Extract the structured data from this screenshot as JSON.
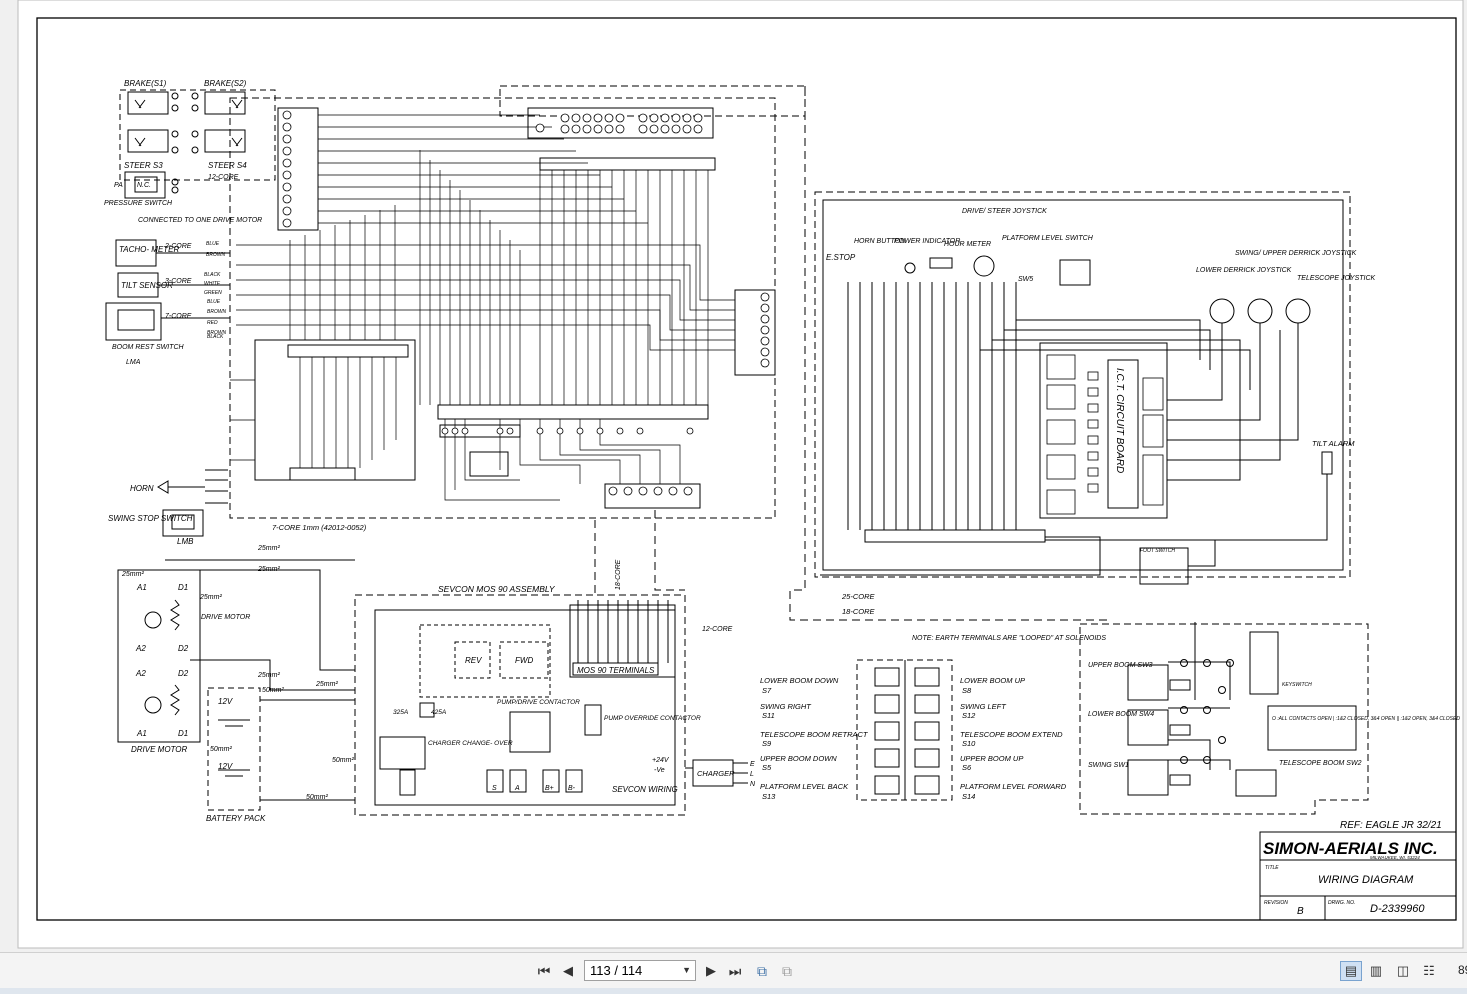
{
  "diagram": {
    "components": {
      "brake_s1": "BRAKE(S1)",
      "brake_s2": "BRAKE(S2)",
      "steer_s3": "STEER S3",
      "steer_s4": "STEER S4",
      "twelve_core": "12-CORE",
      "pressure_switch": "PRESSURE SWITCH",
      "pa": "PA",
      "nc": "N.C.",
      "connected_drive_motor": "CONNECTED TO ONE DRIVE MOTOR",
      "tachometer": "TACHO- METER",
      "two_core": "2-CORE",
      "tilt_sensor": "TILT SENSOR",
      "three_core": "3-CORE",
      "seven_core": "7-CORE",
      "boom_rest_switch": "BOOM REST SWITCH",
      "lma": "LMA",
      "horn": "HORN",
      "swing_stop_switch": "SWING STOP SWITCH",
      "lmb": "LMB",
      "seven_core_1mm": "7-CORE 1mm (42012-0052)",
      "drive_motor": "DRIVE MOTOR",
      "drive_motor_bottom": "DRIVE MOTOR",
      "battery_pack": "BATTERY PACK",
      "twelve_v": "12V",
      "sevcon_assembly": "SEVCON MOS 90 ASSEMBLY",
      "mos90_terminals": "MOS 90 TERMINALS",
      "rev": "REV",
      "fwd": "FWD",
      "pump_drive_contactor": "PUMP/DRIVE CONTACTOR",
      "pump_override_contactor": "PUMP OVERRIDE CONTACTOR",
      "charger_changeover": "CHARGER CHANGE- OVER",
      "sevcon_wiring": "SEVCON WIRING",
      "charger": "CHARGER",
      "plus24v": "+24V",
      "minus_ve": "-Ve",
      "eighteen_core_vert": "18-CORE",
      "twelve_core_b": "12-CORE",
      "e_stop": "E.STOP",
      "horn_button": "HORN BUTTON",
      "power_indicator": "POWER INDICATOR",
      "hour_meter": "HOUR METER",
      "drive_steer_joystick": "DRIVE/ STEER JOYSTICK",
      "platform_level_switch": "PLATFORM LEVEL SWITCH",
      "sw5": "SW5",
      "lower_derrick_joystick": "LOWER DERRICK JOYSTICK",
      "swing_upper_derrick_joystick": "SWING/ UPPER DERRICK JOYSTICK",
      "telescope_joystick": "TELESCOPE JOYSTICK",
      "ict_board": "I.C.T. CIRCUIT BOARD",
      "tilt_alarm": "TILT ALARM",
      "foot_switch": "FOOT SWITCH",
      "twenty_five_core": "25-CORE",
      "eighteen_core": "18-CORE",
      "earth_note": "NOTE: EARTH TERMINALS ARE \"LOOPED\" AT SOLENOIDS",
      "upper_boom_sw3": "UPPER BOOM SW3",
      "lower_boom_sw4": "LOWER BOOM SW4",
      "swing_sw1": "SWING SW1",
      "telescope_boom_sw2": "TELESCOPE BOOM SW2",
      "keyswitch": "KEYSWITCH",
      "contacts_note": "O :ALL CONTACTS OPEN | :1&2 CLOSED, 3&4 OPEN || :1&2 OPEN, 3&4 CLOSED"
    },
    "solenoids_left": [
      {
        "label": "LOWER BOOM DOWN",
        "code": "S7"
      },
      {
        "label": "SWING RIGHT",
        "code": "S11"
      },
      {
        "label": "TELESCOPE BOOM RETRACT",
        "code": "S9"
      },
      {
        "label": "UPPER BOOM DOWN",
        "code": "S5"
      },
      {
        "label": "PLATFORM LEVEL BACK",
        "code": "S13"
      }
    ],
    "solenoids_right": [
      {
        "label": "LOWER BOOM UP",
        "code": "S8"
      },
      {
        "label": "SWING LEFT",
        "code": "S12"
      },
      {
        "label": "TELESCOPE BOOM EXTEND",
        "code": "S10"
      },
      {
        "label": "UPPER BOOM UP",
        "code": "S6"
      },
      {
        "label": "PLATFORM LEVEL FORWARD",
        "code": "S14"
      }
    ],
    "wire_colors": [
      "BLUE",
      "BROWN",
      "BLACK",
      "WHITE",
      "GREEN",
      "BLUE",
      "BROWN",
      "RED",
      "BROWN",
      "BLACK"
    ],
    "cable_sizes": [
      "25mm²",
      "25mm²",
      "25mm²",
      "25mm²",
      "25mm²",
      "25mm²",
      "50mm²",
      "50mm²",
      "50mm²",
      "50mm²"
    ],
    "fuses": [
      "325A",
      "425A"
    ],
    "charger_lines": [
      "E",
      "L",
      "N"
    ],
    "motor_terminals": [
      "A1",
      "D1",
      "A2",
      "D2",
      "A2",
      "D2",
      "A1",
      "D1"
    ],
    "sevcon_terminals": [
      "S",
      "A",
      "B+",
      "B-"
    ]
  },
  "title_block": {
    "ref": "REF: EAGLE JR 32/21",
    "company": "SIMON-AERIALS INC.",
    "address": "MILWAUKEE, WI. 53224",
    "title_label": "TITLE",
    "title": "WIRING DIAGRAM",
    "revision_label": "REVISION",
    "revision": "B",
    "drawing_label": "DRWG. NO.",
    "drawing_no": "D-2339960"
  },
  "toolbar": {
    "page_indicator": "113 / 114",
    "zoom": "89"
  }
}
